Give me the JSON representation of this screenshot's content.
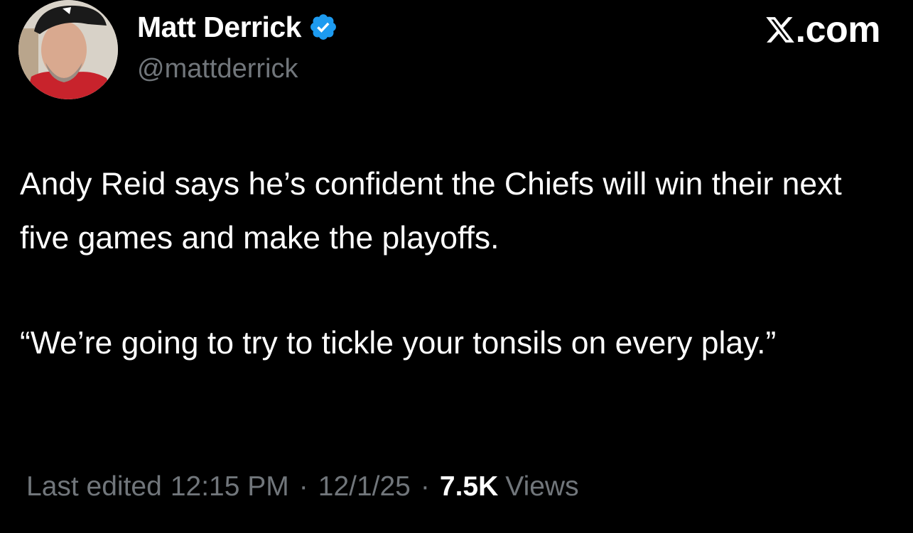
{
  "author": {
    "display_name": "Matt Derrick",
    "handle": "@mattderrick",
    "verified": true,
    "avatar_icon": "profile-photo-avatar"
  },
  "brand": {
    "text": ".com",
    "logo_icon": "x-logo-icon"
  },
  "tweet": {
    "paragraphs": [
      "Andy Reid says he’s confident the Chiefs will win their next five games and make the playoffs.",
      "“We’re going to try to tickle your tonsils on every play.”"
    ]
  },
  "meta": {
    "edited_label": "Last edited",
    "time": "12:15 PM",
    "date": "12/1/25",
    "separator": "·",
    "views_count": "7.5K",
    "views_label": "Views"
  },
  "colors": {
    "background": "#000000",
    "text_primary": "#ffffff",
    "text_secondary": "#71767b",
    "verified_badge": "#1d9bf0"
  }
}
